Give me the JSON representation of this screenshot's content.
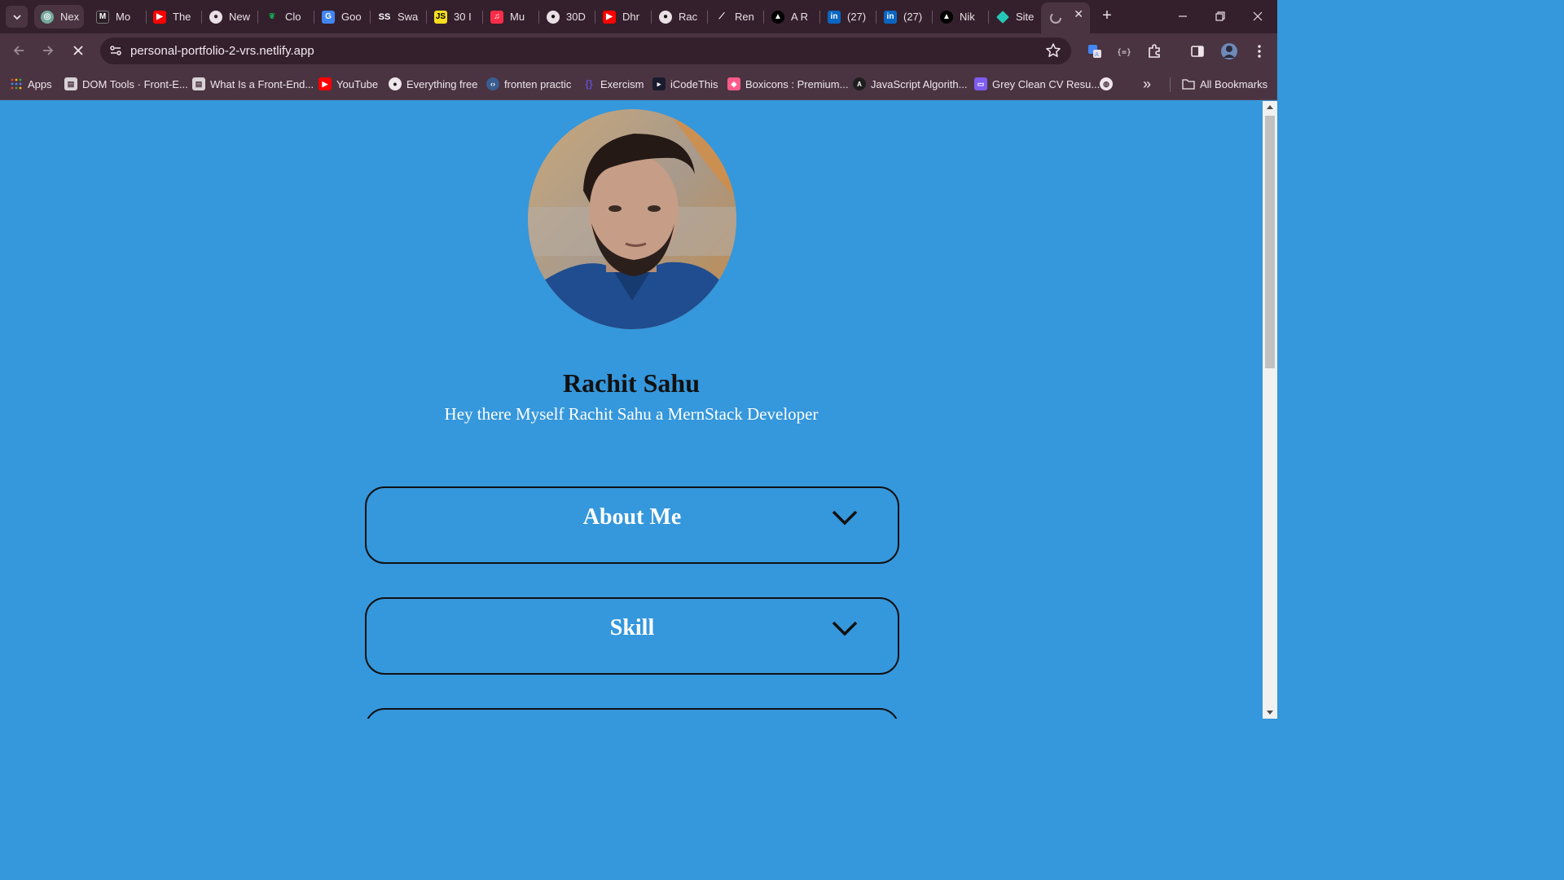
{
  "browser": {
    "tabs": [
      {
        "label": "Nex",
        "icon": "chatgpt-icon"
      },
      {
        "label": "Mo",
        "icon": "notion-icon"
      },
      {
        "label": "The",
        "icon": "youtube-icon"
      },
      {
        "label": "New",
        "icon": "chrome-icon"
      },
      {
        "label": "Clo",
        "icon": "mongodb-icon"
      },
      {
        "label": "Goo",
        "icon": "google-translate-icon"
      },
      {
        "label": "Swa",
        "icon": "ss-icon"
      },
      {
        "label": "30 I",
        "icon": "js-icon"
      },
      {
        "label": "Mu",
        "icon": "music-icon"
      },
      {
        "label": "30D",
        "icon": "github-icon"
      },
      {
        "label": "Dhr",
        "icon": "youtube-icon"
      },
      {
        "label": "Rac",
        "icon": "github-icon"
      },
      {
        "label": "Ren",
        "icon": "render-icon"
      },
      {
        "label": "A R",
        "icon": "vercel-icon"
      },
      {
        "label": "(27)",
        "icon": "linkedin-icon"
      },
      {
        "label": "(27)",
        "icon": "linkedin-icon"
      },
      {
        "label": "Nik",
        "icon": "vercel-icon"
      },
      {
        "label": "Site",
        "icon": "netlify-icon"
      }
    ],
    "active_tab_close": "✕",
    "new_tab": "+",
    "url": "personal-portfolio-2-vrs.netlify.app",
    "bookmarks": [
      {
        "label": "Apps",
        "icon": "apps-grid-icon"
      },
      {
        "label": "DOM Tools · Front-E...",
        "icon": "book-icon"
      },
      {
        "label": "What Is a Front-End...",
        "icon": "book-icon"
      },
      {
        "label": "YouTube",
        "icon": "youtube-icon"
      },
      {
        "label": "Everything free",
        "icon": "github-icon"
      },
      {
        "label": "fronten practic",
        "icon": "code-icon"
      },
      {
        "label": "Exercism",
        "icon": "exercism-icon"
      },
      {
        "label": "iCodeThis",
        "icon": "icodethis-icon"
      },
      {
        "label": "Boxicons : Premium...",
        "icon": "boxicons-icon"
      },
      {
        "label": "JavaScript Algorith...",
        "icon": "js-algo-icon"
      },
      {
        "label": "Grey Clean CV Resu...",
        "icon": "canva-icon"
      }
    ],
    "more_bookmarks": "»",
    "all_bookmarks": "All Bookmarks"
  },
  "page": {
    "name": "Rachit Sahu",
    "tagline": "Hey there Myself Rachit Sahu a MernStack Developer",
    "sections": [
      {
        "title": "About Me"
      },
      {
        "title": "Skill"
      },
      {
        "title": ""
      }
    ]
  },
  "colors": {
    "page_background": "#3597dc",
    "browser_frame": "#34202c",
    "toolbar": "#4a3441"
  }
}
